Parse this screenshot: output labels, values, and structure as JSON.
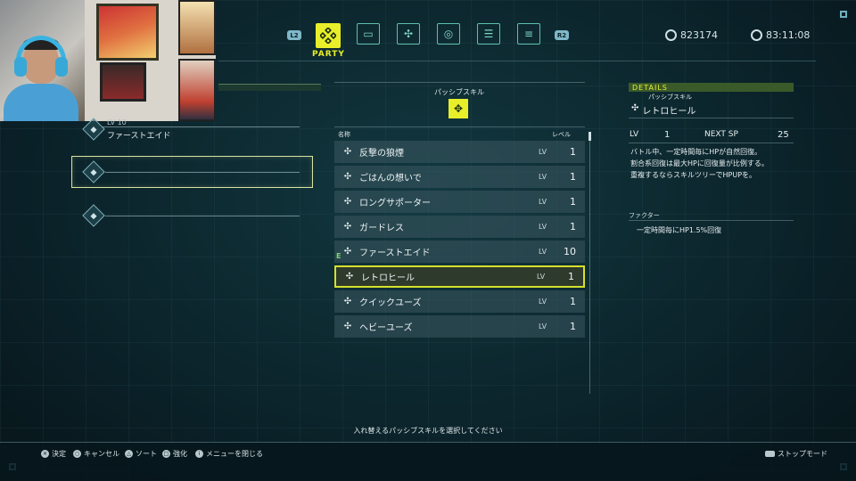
{
  "header": {
    "shoulder_left": "L2",
    "shoulder_right": "R2",
    "active_tab_label": "PARTY",
    "tabs": [
      {
        "icon": "party-icon"
      },
      {
        "icon": "card-icon"
      },
      {
        "icon": "tree-icon"
      },
      {
        "icon": "materia-icon"
      },
      {
        "icon": "list-icon"
      },
      {
        "icon": "settings-icon"
      }
    ],
    "gil": "823174",
    "playtime": "83:11:08"
  },
  "left_panel": {
    "slot1_level": "LV 10",
    "slot1_name": "ファーストエイド"
  },
  "center": {
    "section_title": "パッシブスキル",
    "col_name": "名称",
    "col_level": "レベル",
    "equipped_marker": "E",
    "skills": [
      {
        "name": "反撃の狼煙",
        "lv_label": "LV",
        "lv": "1"
      },
      {
        "name": "ごはんの想いで",
        "lv_label": "LV",
        "lv": "1"
      },
      {
        "name": "ロングサポーター",
        "lv_label": "LV",
        "lv": "1"
      },
      {
        "name": "ガードレス",
        "lv_label": "LV",
        "lv": "1"
      },
      {
        "name": "ファーストエイド",
        "lv_label": "LV",
        "lv": "10"
      },
      {
        "name": "レトロヒール",
        "lv_label": "LV",
        "lv": "1"
      },
      {
        "name": "クイックユーズ",
        "lv_label": "LV",
        "lv": "1"
      },
      {
        "name": "ヘビーユーズ",
        "lv_label": "LV",
        "lv": "1"
      }
    ],
    "selected_index": 5,
    "footer_prompt": "入れ替えるパッシブスキルを選択してください"
  },
  "details": {
    "header": "DETAILS",
    "category": "パッシブスキル",
    "skill_name": "レトロヒール",
    "lv_label": "LV",
    "lv_value": "1",
    "next_sp_label": "NEXT SP",
    "next_sp_value": "25",
    "desc_lines": [
      "バトル中、一定時間毎にHPが自然回復。",
      "割合系回復は最大HPに回復量が比例する。",
      "重複するならスキルツリーでHPUPを。"
    ],
    "factor_label": "ファクター",
    "factor_text": "一定時間毎にHP1.5%回復"
  },
  "bottom": {
    "hints": [
      {
        "btn": "✕",
        "label": "決定"
      },
      {
        "btn": "○",
        "label": "キャンセル"
      },
      {
        "btn": "△",
        "label": "ソート"
      },
      {
        "btn": "□",
        "label": "強化"
      },
      {
        "btn": "i",
        "label": "メニューを閉じる"
      }
    ],
    "stop_mode": "ストップモード"
  },
  "colors": {
    "accent_yellow": "#e8ef2a",
    "teal": "#5fbfb0",
    "background": "#0b2229"
  }
}
